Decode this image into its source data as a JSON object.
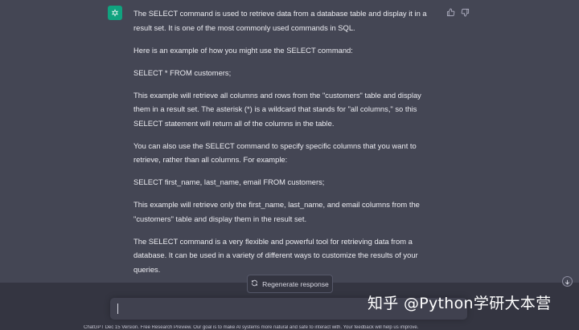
{
  "message": {
    "paragraphs": [
      "The SELECT command is used to retrieve data from a database table and display it in a result set. It is one of the most commonly used commands in SQL.",
      "Here is an example of how you might use the SELECT command:",
      "SELECT * FROM customers;",
      "This example will retrieve all columns and rows from the \"customers\" table and display them in a result set. The asterisk (*) is a wildcard that stands for \"all columns,\" so this SELECT statement will return all of the columns in the table.",
      "You can also use the SELECT command to specify specific columns that you want to retrieve, rather than all columns. For example:",
      "SELECT first_name, last_name, email FROM customers;",
      "This example will retrieve only the first_name, last_name, and email columns from the \"customers\" table and display them in the result set.",
      "The SELECT command is a very flexible and powerful tool for retrieving data from a database. It can be used in a variety of different ways to customize the results of your queries."
    ]
  },
  "controls": {
    "regenerate_label": "Regenerate response"
  },
  "footer": {
    "note": "ChatGPT Dec 15 Version. Free Research Preview. Our goal is to make AI systems more natural and safe to interact with. Your feedback will help us improve."
  },
  "watermark": {
    "text": "知乎 @Python学研大本营"
  },
  "colors": {
    "page_bg": "#343541",
    "message_bg": "#444654",
    "accent": "#10a37f",
    "text": "#ececf1"
  },
  "icons": {
    "avatar": "openai-logo-icon",
    "thumbs_up": "thumbs-up-icon",
    "thumbs_down": "thumbs-down-icon",
    "regenerate": "refresh-icon",
    "scroll": "arrow-down-icon"
  }
}
